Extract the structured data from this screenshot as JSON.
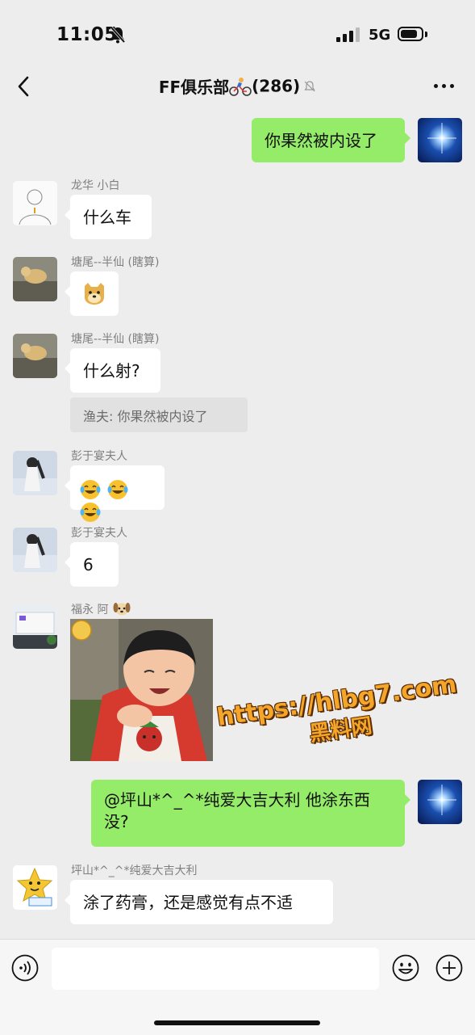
{
  "status_bar": {
    "time": "11:05",
    "network": "5G",
    "battery_level": 0.8
  },
  "nav": {
    "title": "FF俱乐部",
    "member_count": "(286)"
  },
  "messages": [
    {
      "side": "right",
      "text": "你果然被内设了"
    },
    {
      "side": "left",
      "sender": "龙华  小白",
      "text": "什么车"
    },
    {
      "side": "left",
      "sender": "塘尾--半仙 (瞎算)",
      "sticker": "doge-emoji"
    },
    {
      "side": "left",
      "sender": "塘尾--半仙 (瞎算)",
      "text": "什么射?",
      "quote": "渔夫: 你果然被内设了"
    },
    {
      "side": "left",
      "sender": "彭于宴夫人",
      "emoji": "laughing-tears-emoji x3"
    },
    {
      "side": "left",
      "sender": "彭于宴夫人",
      "text": "6"
    },
    {
      "side": "left",
      "sender": "福永 阿",
      "image": "baby-photo"
    },
    {
      "side": "right",
      "text": "@坪山*^_^*纯爱大吉大利 他涂东西没?"
    },
    {
      "side": "left",
      "sender": "坪山*^_^*纯爱大吉大利",
      "text": "涂了药膏，还是感觉有点不适"
    }
  ],
  "watermark": {
    "url": "https://hlbg7.com",
    "site": "黑料网"
  },
  "input_bar": {
    "placeholder": ""
  },
  "colors": {
    "self_bubble": "#95ec69",
    "other_bubble": "#ffffff",
    "background": "#ededed"
  }
}
